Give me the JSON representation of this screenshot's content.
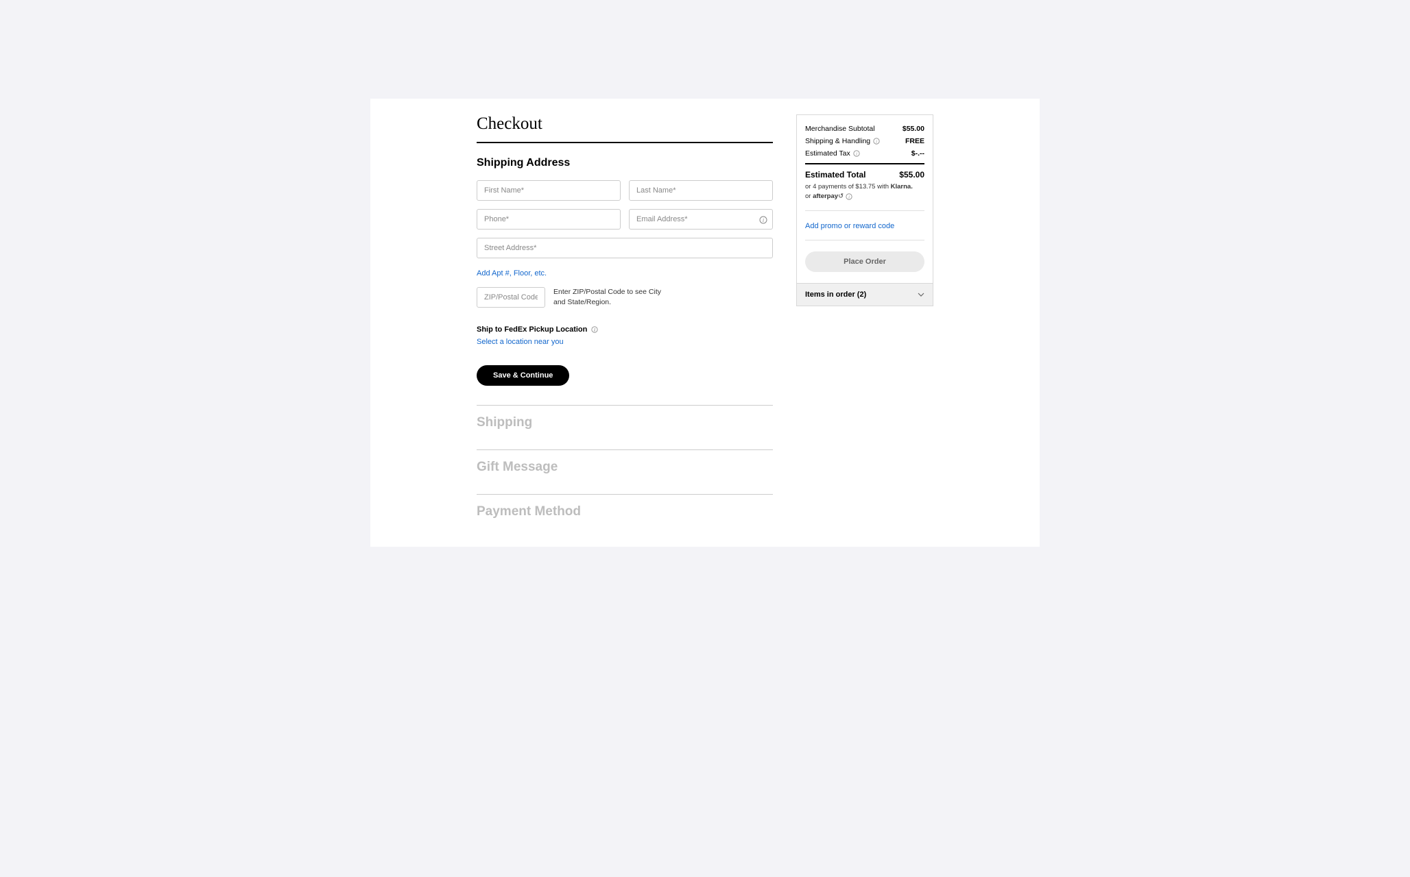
{
  "page": {
    "title": "Checkout"
  },
  "shipping_address": {
    "heading": "Shipping Address",
    "first_name_placeholder": "First Name*",
    "last_name_placeholder": "Last Name*",
    "phone_placeholder": "Phone*",
    "email_placeholder": "Email Address*",
    "street_placeholder": "Street Address*",
    "add_apt_link": "Add Apt #, Floor, etc.",
    "zip_placeholder": "ZIP/Postal Code*",
    "zip_hint": "Enter ZIP/Postal Code to see City and State/Region.",
    "fedex_label": "Ship to FedEx Pickup Location",
    "fedex_link": "Select a location near you",
    "save_button": "Save & Continue"
  },
  "sections": {
    "shipping": "Shipping",
    "gift": "Gift Message",
    "payment": "Payment Method"
  },
  "summary": {
    "subtotal_label": "Merchandise Subtotal",
    "subtotal_value": "$55.00",
    "shipping_label": "Shipping & Handling",
    "shipping_value": "FREE",
    "tax_label": "Estimated Tax",
    "tax_value": "$-.--",
    "total_label": "Estimated Total",
    "total_value": "$55.00",
    "installments_prefix": "or 4 payments of $13.75 with ",
    "klarna": "Klarna.",
    "or_text": "or ",
    "afterpay": "afterpay",
    "promo_link": "Add promo or reward code",
    "place_order": "Place Order",
    "items_label": "Items in order (2)"
  }
}
